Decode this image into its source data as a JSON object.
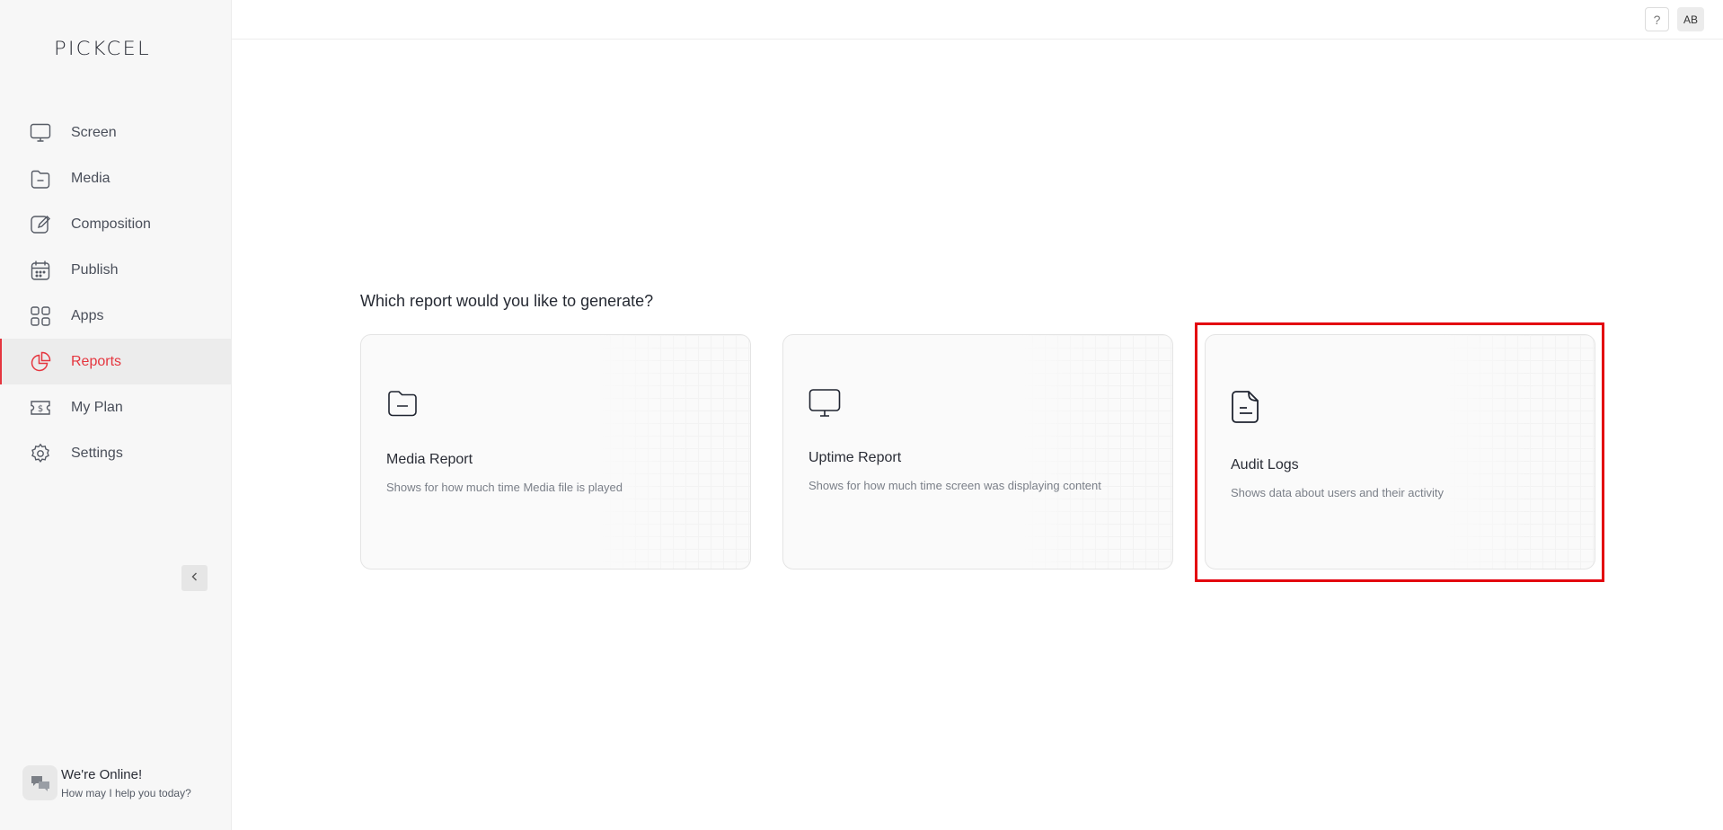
{
  "brand": {
    "logo_text": "PICKCEL"
  },
  "sidebar": {
    "items": [
      {
        "label": "Screen",
        "icon": "monitor-icon",
        "active": false
      },
      {
        "label": "Media",
        "icon": "folder-icon",
        "active": false
      },
      {
        "label": "Composition",
        "icon": "edit-icon",
        "active": false
      },
      {
        "label": "Publish",
        "icon": "calendar-icon",
        "active": false
      },
      {
        "label": "Apps",
        "icon": "apps-grid-icon",
        "active": false
      },
      {
        "label": "Reports",
        "icon": "pie-chart-icon",
        "active": true
      },
      {
        "label": "My Plan",
        "icon": "dollar-ticket-icon",
        "active": false
      },
      {
        "label": "Settings",
        "icon": "gear-icon",
        "active": false
      }
    ],
    "collapse_icon": "chevron-left-icon"
  },
  "chat": {
    "title": "We're Online!",
    "subtitle": "How may I help you today?",
    "icon": "chat-bubbles-icon"
  },
  "topbar": {
    "help_label": "?",
    "avatar_initials": "AB"
  },
  "main": {
    "question": "Which report would you like to generate?",
    "cards": [
      {
        "title": "Media Report",
        "description": "Shows for how much time Media file is played",
        "icon": "folder-icon"
      },
      {
        "title": "Uptime Report",
        "description": "Shows for how much time screen was displaying content",
        "icon": "monitor-icon"
      },
      {
        "title": "Audit Logs",
        "description": "Shows data about users and their activity",
        "icon": "document-icon"
      }
    ]
  },
  "colors": {
    "accent": "#e5363f",
    "highlight": "#e3000f",
    "sidebar_bg": "#f7f7f7"
  }
}
